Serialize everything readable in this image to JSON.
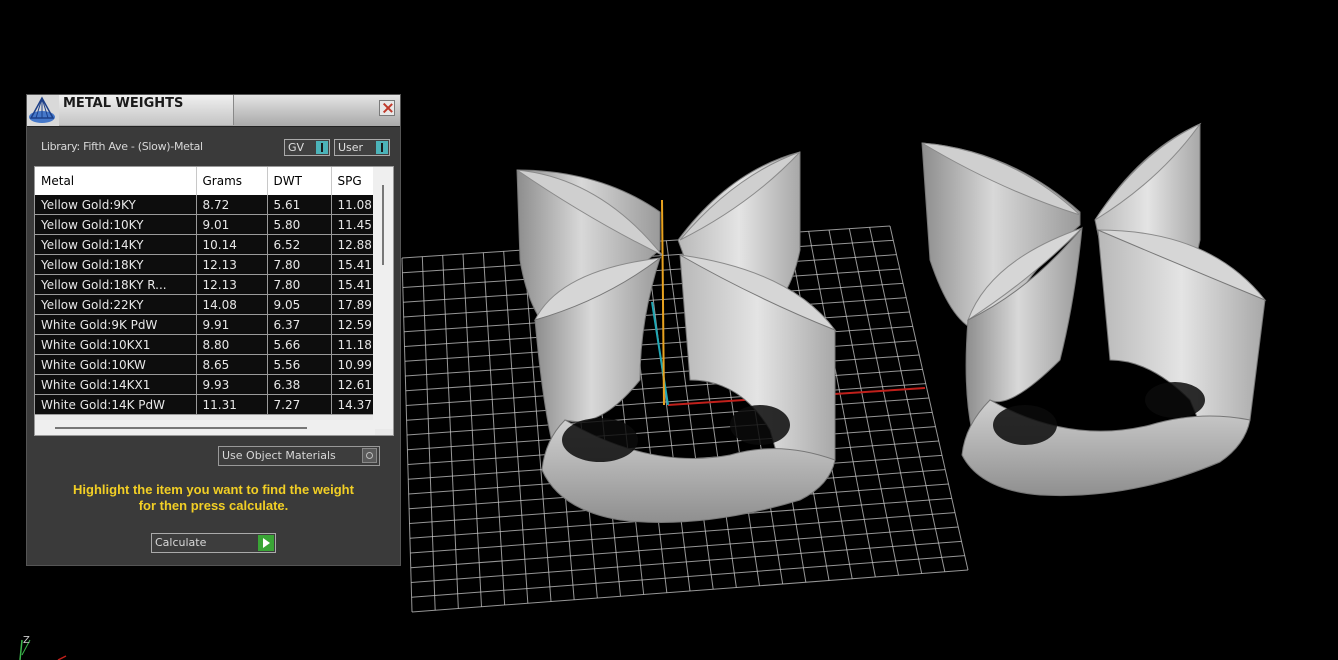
{
  "panel": {
    "title": "METAL WEIGHTS",
    "library_label": "Library: Fifth Ave - (Slow)-Metal",
    "gv_select": "GV",
    "user_select": "User",
    "columns": [
      "Metal",
      "Grams",
      "DWT",
      "SPG"
    ],
    "rows": [
      [
        "Yellow Gold:9KY",
        "8.72",
        "5.61",
        "11.08"
      ],
      [
        "Yellow Gold:10KY",
        "9.01",
        "5.80",
        "11.45"
      ],
      [
        "Yellow Gold:14KY",
        "10.14",
        "6.52",
        "12.88"
      ],
      [
        "Yellow Gold:18KY",
        "12.13",
        "7.80",
        "15.41"
      ],
      [
        "Yellow Gold:18KY R...",
        "12.13",
        "7.80",
        "15.41"
      ],
      [
        "Yellow Gold:22KY",
        "14.08",
        "9.05",
        "17.89"
      ],
      [
        "White Gold:9K PdW",
        "9.91",
        "6.37",
        "12.59"
      ],
      [
        "White Gold:10KX1",
        "8.80",
        "5.66",
        "11.18"
      ],
      [
        "White Gold:10KW",
        "8.65",
        "5.56",
        "10.99"
      ],
      [
        "White Gold:14KX1",
        "9.93",
        "6.38",
        "12.61"
      ],
      [
        "White Gold:14K PdW",
        "11.31",
        "7.27",
        "14.37"
      ]
    ],
    "use_object_materials": "Use Object Materials",
    "instruction_line1": "Highlight the item you want to find the weight",
    "instruction_line2": "for then press calculate.",
    "calculate_label": "Calculate"
  },
  "viewport": {
    "axis_label": "Z",
    "colors": {
      "background": "#000000",
      "grid": "#c8c8c8",
      "x_axis": "#c0201b",
      "y_axis": "#1fa7b4",
      "z_axis": "#e8a21f",
      "model": "#c4c4c4",
      "instruction_text": "#f2cf25"
    }
  }
}
